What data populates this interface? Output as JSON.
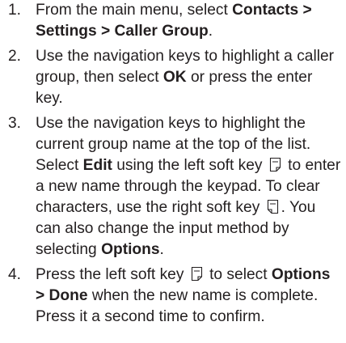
{
  "steps": [
    {
      "number": "1.",
      "t1": "From the main menu, select ",
      "b1": "Contacts > Settings > Caller Group",
      "t2": "."
    },
    {
      "number": "2.",
      "t1": "Use the navigation keys to highlight a caller group, then select ",
      "b1": "OK",
      "t2": " or press the enter key."
    },
    {
      "number": "3.",
      "t1": "Use the navigation keys to highlight the current group name at the top of the list.",
      "t2": "Select ",
      "b1": "Edit",
      "t3": " using the left soft key ",
      "t4": " to enter a new name through the keypad. To clear characters, use the right soft key ",
      "t5": ". You can also change the input method by selecting ",
      "b2": "Options",
      "t6": "."
    },
    {
      "number": "4.",
      "t1": "Press the left soft key ",
      "t2": " to select ",
      "b1": "Options > Done",
      "t3": " when the new name is complete. Press it a second time to confirm."
    }
  ],
  "icons": {
    "left_soft_key": "left-soft-key-icon",
    "right_soft_key": "right-soft-key-icon"
  }
}
